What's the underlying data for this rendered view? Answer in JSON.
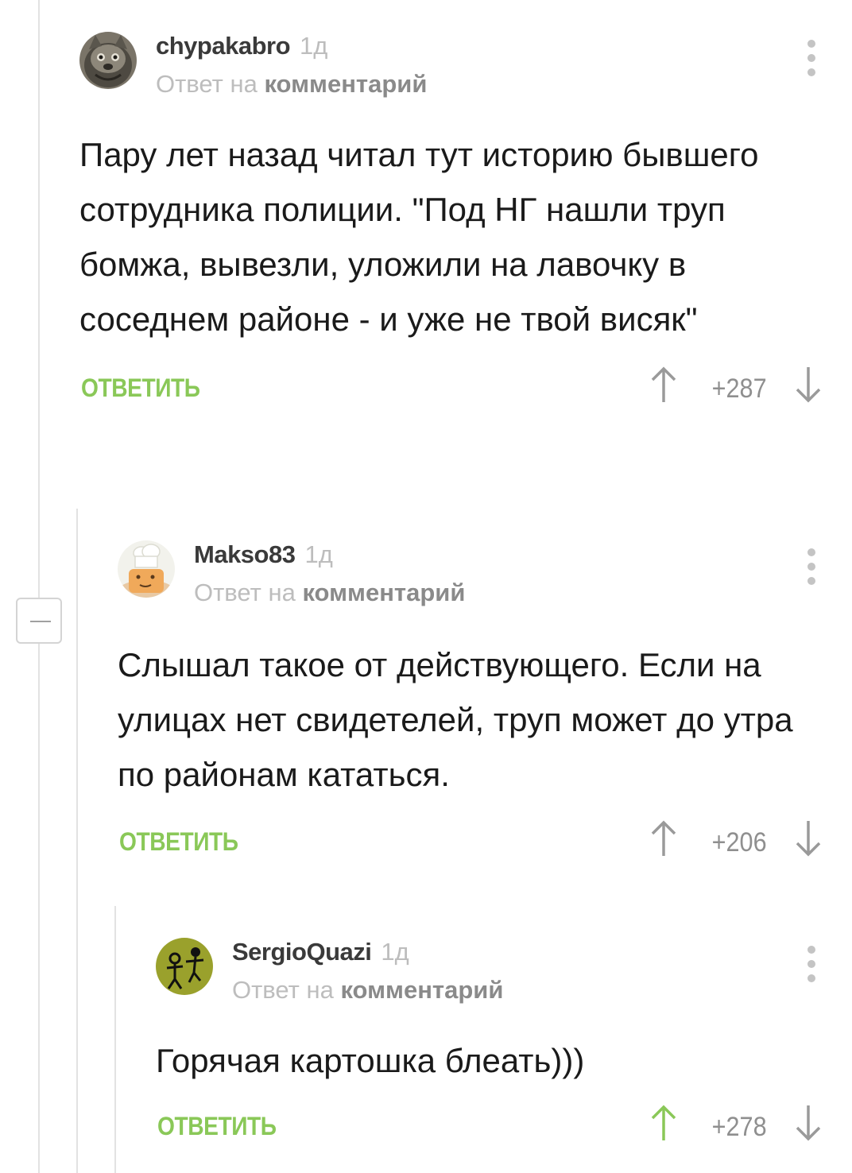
{
  "comments": [
    {
      "nick": "chypakabro",
      "time": "1д",
      "reply_prefix": "Ответ на",
      "reply_link": "комментарий",
      "text": "Пару лет назад читал тут историю бывшего сотрудника полиции. \"Под НГ нашли труп бомжа, вывезли, уложили на лавочку в соседнем районе - и уже не твой висяк\"",
      "answer_label": "ОТВЕТИТЬ",
      "rating": "+287",
      "upvoted": false
    },
    {
      "nick": "Makso83",
      "time": "1д",
      "reply_prefix": "Ответ на",
      "reply_link": "комментарий",
      "text": "Слышал такое от действующего. Если на улицах нет свидетелей, труп может до утра по районам кататься.",
      "answer_label": "ОТВЕТИТЬ",
      "rating": "+206",
      "upvoted": false
    },
    {
      "nick": "SergioQuazi",
      "time": "1д",
      "reply_prefix": "Ответ на",
      "reply_link": "комментарий",
      "text": "Горячая картошка блеать)))",
      "answer_label": "ОТВЕТИТЬ",
      "rating": "+278",
      "upvoted": true
    }
  ],
  "colors": {
    "accent_green": "#8ac858",
    "muted_gray": "#bdbdbd",
    "vote_gray": "#9a9a9a"
  },
  "icons": [
    "cat-avatar",
    "cook-avatar",
    "stick-figures-avatar",
    "more-vertical-icon",
    "arrow-up-icon",
    "arrow-down-icon",
    "collapse-minus-icon"
  ]
}
